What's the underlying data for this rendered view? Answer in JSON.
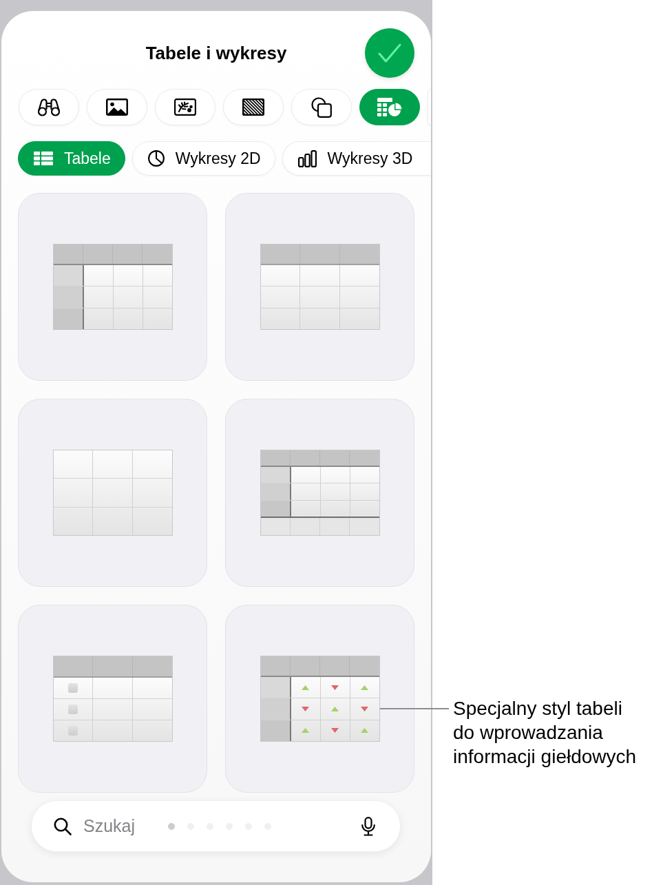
{
  "sheet": {
    "title": "Tabele i wykresy"
  },
  "insert_tabs": [
    {
      "selected": false
    },
    {
      "selected": false
    },
    {
      "selected": false
    },
    {
      "selected": false
    },
    {
      "selected": false
    },
    {
      "selected": true
    },
    {
      "selected": false
    }
  ],
  "type_tabs": [
    {
      "label": "Tabele",
      "selected": true
    },
    {
      "label": "Wykresy 2D",
      "selected": false
    },
    {
      "label": "Wykresy 3D",
      "selected": false
    }
  ],
  "table_styles": [
    {
      "kind": "headers"
    },
    {
      "kind": "header"
    },
    {
      "kind": "plain"
    },
    {
      "kind": "footer"
    },
    {
      "kind": "checkbox",
      "checkboxes": [
        {
          "checked": false
        },
        {
          "checked": false
        },
        {
          "checked": false
        }
      ]
    },
    {
      "kind": "stock",
      "trends": [
        [
          {
            "rising": true
          },
          {
            "rising": false
          },
          {
            "rising": true
          }
        ],
        [
          {
            "rising": false
          },
          {
            "rising": true
          },
          {
            "rising": false
          }
        ],
        [
          {
            "rising": true
          },
          {
            "rising": false
          },
          {
            "rising": true
          }
        ]
      ]
    }
  ],
  "search": {
    "placeholder": "Szukaj",
    "page_indicator": [
      {
        "selected": true
      },
      {
        "selected": false
      },
      {
        "selected": false
      },
      {
        "selected": false
      },
      {
        "selected": false
      },
      {
        "selected": false
      }
    ]
  },
  "callout": {
    "lines": [
      "Specjalny styl tabeli",
      "do wprowadzania",
      "informacji giełdowych"
    ]
  }
}
